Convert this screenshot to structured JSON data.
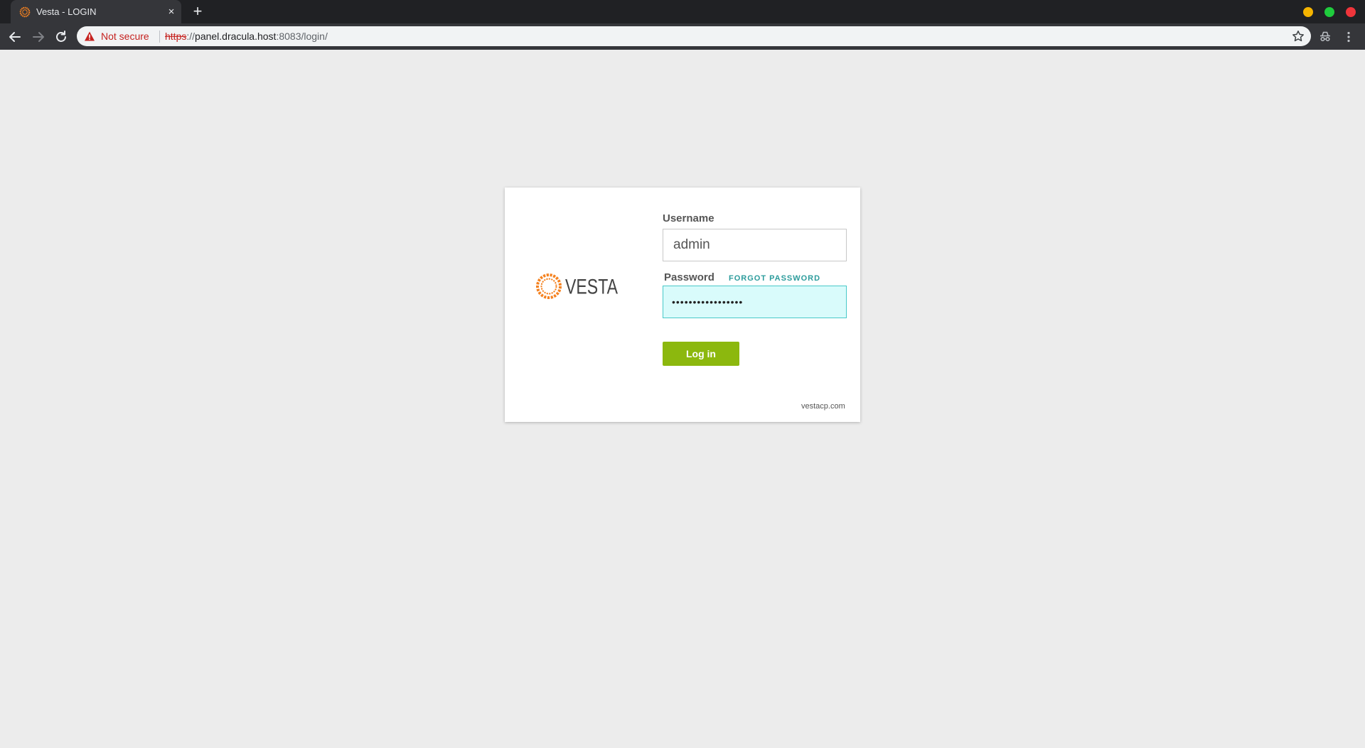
{
  "browser": {
    "tab": {
      "title": "Vesta - LOGIN",
      "close_glyph": "×"
    },
    "new_tab_glyph": "+",
    "address_bar": {
      "security_label": "Not secure",
      "url_scheme": "https",
      "url_separator": "://",
      "url_host": "panel.dracula.host",
      "url_rest": ":8083/login/"
    },
    "window_controls": {
      "minimize_color": "#f5b400",
      "maximize_color": "#1fcc3d",
      "close_color": "#f0353b"
    }
  },
  "login": {
    "logo_text": "VESTA",
    "username_label": "Username",
    "username_value": "admin",
    "password_label": "Password",
    "forgot_password": "FORGOT PASSWORD",
    "password_value": "•••••••••••••••••",
    "login_button": "Log in",
    "footer_link": "vestacp.com"
  },
  "colors": {
    "accent_green": "#8cb80e",
    "link_teal": "#2c9c9c",
    "logo_orange": "#f58220",
    "focus_field_bg": "#d9fbfb",
    "insecure_red": "#c5221f"
  },
  "icons": {
    "favicon": "vesta-favicon-icon",
    "back": "arrow-left-icon",
    "forward": "arrow-right-icon",
    "reload": "reload-icon",
    "warning": "warning-triangle-icon",
    "bookmark": "star-icon",
    "extension": "incognito-icon",
    "menu": "kebab-menu-icon"
  }
}
